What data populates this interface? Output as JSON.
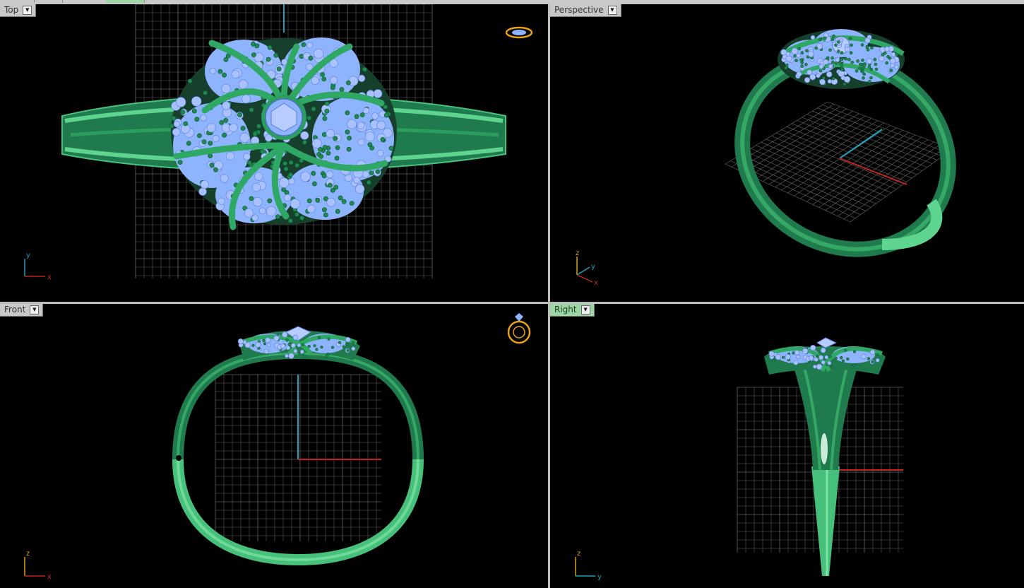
{
  "viewports": {
    "top": {
      "label": "Top",
      "axes": [
        "y",
        "x"
      ]
    },
    "perspective": {
      "label": "Perspective",
      "axes": [
        "z",
        "y",
        "x"
      ]
    },
    "front": {
      "label": "Front",
      "axes": [
        "z",
        "x"
      ]
    },
    "right": {
      "label": "Right",
      "axes": [
        "z",
        "y"
      ]
    }
  },
  "active_viewport": "right",
  "colors": {
    "background": "#000000",
    "metal_dark": "#1f7a4d",
    "metal_light": "#4fc47a",
    "gem": "#8fb4ff",
    "grid": "#6e6e6e",
    "axis_x": "#c0261f",
    "axis_y": "#1fa0b8",
    "axis_z": "#d4a017",
    "label_bg": "#c8c8c8",
    "active_label_bg": "#9fd6a5"
  },
  "icons": [
    "ring-navigation-icon",
    "viewport-menu-arrow-icon"
  ]
}
